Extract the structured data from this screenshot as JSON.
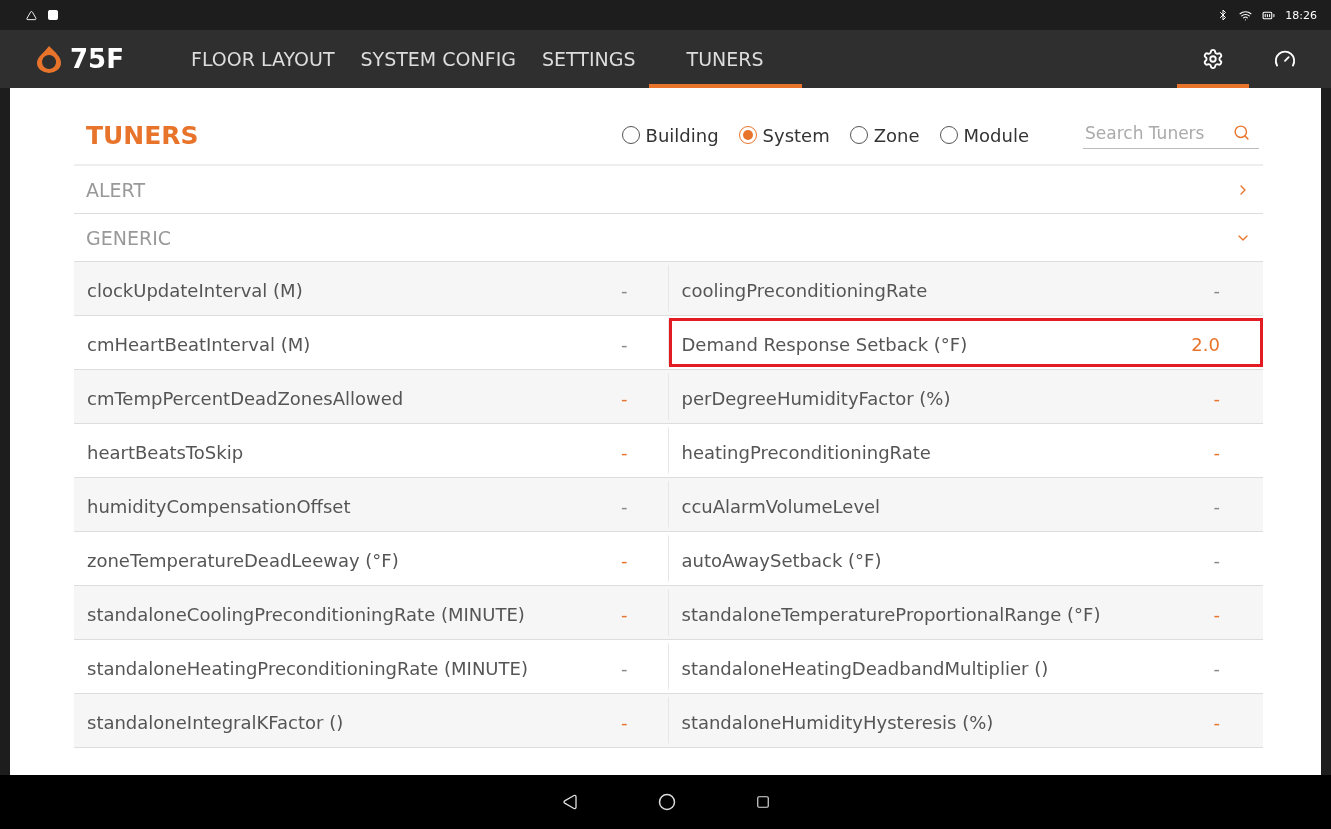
{
  "status_bar": {
    "time": "18:26"
  },
  "nav": {
    "brand": "75F",
    "tabs": [
      {
        "label": "FLOOR LAYOUT",
        "selected": false
      },
      {
        "label": "SYSTEM CONFIG",
        "selected": false
      },
      {
        "label": "SETTINGS",
        "selected": false
      },
      {
        "label": "TUNERS",
        "selected": true
      }
    ],
    "icon_tabs": [
      {
        "kind": "gear",
        "selected": true
      },
      {
        "kind": "gauge",
        "selected": false
      }
    ]
  },
  "title": "TUNERS",
  "scopes": [
    {
      "label": "Building",
      "selected": false
    },
    {
      "label": "System",
      "selected": true
    },
    {
      "label": "Zone",
      "selected": false
    },
    {
      "label": "Module",
      "selected": false
    }
  ],
  "search": {
    "placeholder": "Search Tuners"
  },
  "groups": [
    {
      "label": "ALERT",
      "expanded": false
    },
    {
      "label": "GENERIC",
      "expanded": true
    }
  ],
  "rows": [
    {
      "left": {
        "name": "clockUpdateInterval (M)",
        "value": "-",
        "modified": false,
        "highlighted": false
      },
      "right": {
        "name": "coolingPreconditioningRate",
        "value": "-",
        "modified": false,
        "highlighted": false
      }
    },
    {
      "left": {
        "name": "cmHeartBeatInterval (M)",
        "value": "-",
        "modified": false,
        "highlighted": false
      },
      "right": {
        "name": "Demand Response Setback (°F)",
        "value": "2.0",
        "modified": true,
        "highlighted": true
      }
    },
    {
      "left": {
        "name": "cmTempPercentDeadZonesAllowed",
        "value": "-",
        "modified": true,
        "highlighted": false
      },
      "right": {
        "name": "perDegreeHumidityFactor (%)",
        "value": "-",
        "modified": true,
        "highlighted": false
      }
    },
    {
      "left": {
        "name": "heartBeatsToSkip",
        "value": "-",
        "modified": true,
        "highlighted": false
      },
      "right": {
        "name": "heatingPreconditioningRate",
        "value": "-",
        "modified": true,
        "highlighted": false
      }
    },
    {
      "left": {
        "name": "humidityCompensationOffset",
        "value": "-",
        "modified": false,
        "highlighted": false
      },
      "right": {
        "name": "ccuAlarmVolumeLevel",
        "value": "-",
        "modified": false,
        "highlighted": false
      }
    },
    {
      "left": {
        "name": "zoneTemperatureDeadLeeway (°F)",
        "value": "-",
        "modified": true,
        "highlighted": false
      },
      "right": {
        "name": "autoAwaySetback (°F)",
        "value": "-",
        "modified": false,
        "highlighted": false
      }
    },
    {
      "left": {
        "name": "standaloneCoolingPreconditioningRate (MINUTE)",
        "value": "-",
        "modified": true,
        "highlighted": false
      },
      "right": {
        "name": "standaloneTemperatureProportionalRange (°F)",
        "value": "-",
        "modified": true,
        "highlighted": false
      }
    },
    {
      "left": {
        "name": "standaloneHeatingPreconditioningRate (MINUTE)",
        "value": "-",
        "modified": false,
        "highlighted": false
      },
      "right": {
        "name": "standaloneHeatingDeadbandMultiplier ()",
        "value": "-",
        "modified": false,
        "highlighted": false
      }
    },
    {
      "left": {
        "name": "standaloneIntegralKFactor ()",
        "value": "-",
        "modified": true,
        "highlighted": false
      },
      "right": {
        "name": "standaloneHumidityHysteresis (%)",
        "value": "-",
        "modified": true,
        "highlighted": false
      }
    }
  ]
}
